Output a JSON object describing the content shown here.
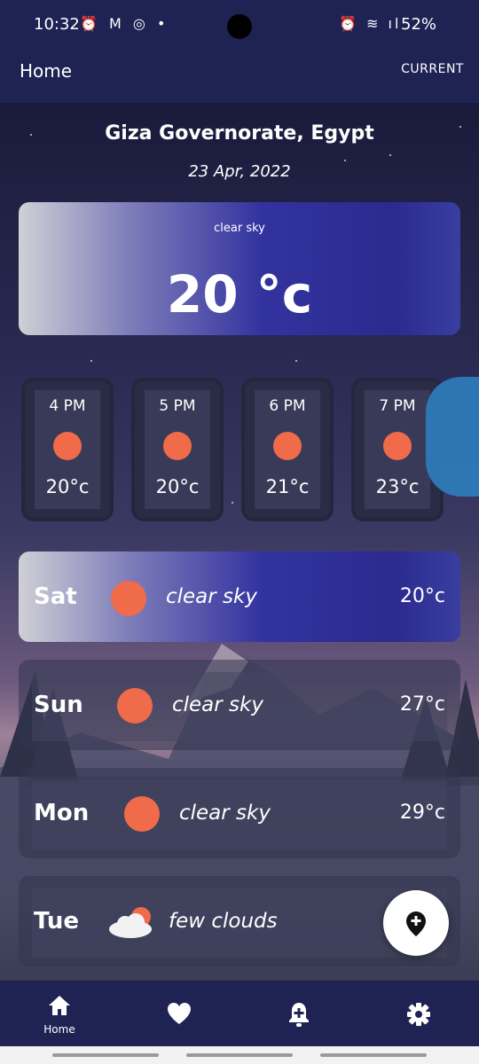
{
  "status_bar": {
    "time": "10:32",
    "left_icons": "⏰ M ◎ •",
    "right_icons": "⏰ ≋ ıl",
    "battery": "52%"
  },
  "app_bar": {
    "title": "Home",
    "action": "CURRENT"
  },
  "location": "Giza Governorate, Egypt",
  "date": "23 Apr, 2022",
  "current": {
    "condition": "clear sky",
    "temperature": "20 °c"
  },
  "hourly": [
    {
      "time": "4 PM",
      "temp": "20°c",
      "icon": "sun-icon"
    },
    {
      "time": "5 PM",
      "temp": "20°c",
      "icon": "sun-icon"
    },
    {
      "time": "6 PM",
      "temp": "21°c",
      "icon": "sun-icon"
    },
    {
      "time": "7 PM",
      "temp": "23°c",
      "icon": "sun-icon"
    }
  ],
  "daily": [
    {
      "day": "Sat",
      "condition": "clear sky",
      "temp": "20°c",
      "icon": "sun-icon"
    },
    {
      "day": "Sun",
      "condition": "clear sky",
      "temp": "27°c",
      "icon": "sun-icon"
    },
    {
      "day": "Mon",
      "condition": "clear sky",
      "temp": "29°c",
      "icon": "sun-icon"
    },
    {
      "day": "Tue",
      "condition": "few clouds",
      "temp": "",
      "icon": "cloud-sun-icon"
    }
  ],
  "fab": {
    "icon": "add-location-icon"
  },
  "bottom_nav": [
    {
      "label": "Home",
      "icon": "home-icon"
    },
    {
      "label": "",
      "icon": "heart-icon"
    },
    {
      "label": "",
      "icon": "add-alert-icon"
    },
    {
      "label": "",
      "icon": "settings-icon"
    }
  ],
  "colors": {
    "accent": "#2a2a8f",
    "sun": "#ef6b4a",
    "bar": "#1e2354"
  }
}
